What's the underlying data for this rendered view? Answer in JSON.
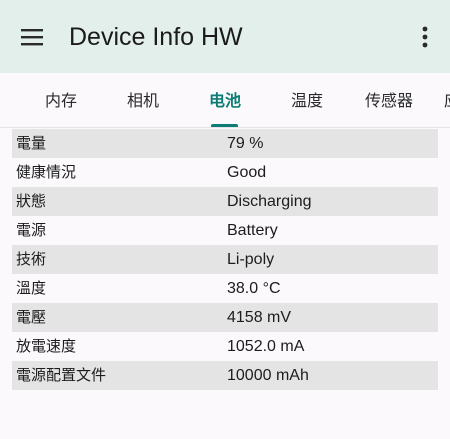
{
  "app_bar": {
    "title": "Device Info HW",
    "menu_icon": "hamburger-menu-icon",
    "more_icon": "more-vert-icon"
  },
  "tabs": [
    {
      "label": "内存"
    },
    {
      "label": "相机"
    },
    {
      "label": "电池",
      "selected": true
    },
    {
      "label": "温度"
    },
    {
      "label": "传感器"
    },
    {
      "label": "应"
    }
  ],
  "battery_info": [
    {
      "key": "電量",
      "value": "79 %"
    },
    {
      "key": "健康情況",
      "value": "Good"
    },
    {
      "key": "狀態",
      "value": "Discharging"
    },
    {
      "key": "電源",
      "value": "Battery"
    },
    {
      "key": "技術",
      "value": "Li-poly"
    },
    {
      "key": "溫度",
      "value": "38.0 °C"
    },
    {
      "key": "電壓",
      "value": "4158 mV"
    },
    {
      "key": "放電速度",
      "value": "1052.0 mA"
    },
    {
      "key": "電源配置文件",
      "value": "10000 mAh"
    }
  ],
  "colors": {
    "accent": "#0b7d74",
    "app_bar_bg": "#e3efeb",
    "row_shade": "#e4e4e4",
    "background": "#fbf9fc"
  }
}
